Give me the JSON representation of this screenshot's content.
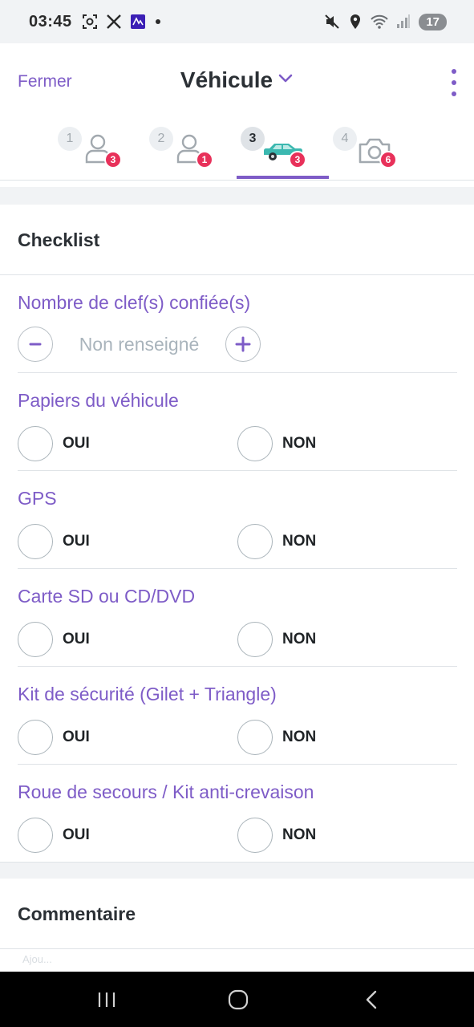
{
  "status_bar": {
    "time": "03:45",
    "battery": "17",
    "left_icons": [
      "screenshot-icon",
      "x-logo-icon",
      "app-notification-icon",
      "dot-icon"
    ],
    "right_icons": [
      "mute-icon",
      "location-icon",
      "wifi-icon",
      "signal-icon"
    ]
  },
  "header": {
    "close_label": "Fermer",
    "title": "Véhicule"
  },
  "steps": [
    {
      "number": "1",
      "icon": "person-icon",
      "badge": "3",
      "active": false
    },
    {
      "number": "2",
      "icon": "person-icon",
      "badge": "1",
      "active": false
    },
    {
      "number": "3",
      "icon": "car-icon",
      "badge": "3",
      "active": true
    },
    {
      "number": "4",
      "icon": "camera-icon",
      "badge": "6",
      "active": false
    }
  ],
  "checklist": {
    "title": "Checklist",
    "keys": {
      "label": "Nombre de clef(s) confiée(s)",
      "value": "Non renseigné"
    },
    "questions": [
      {
        "label": "Papiers du véhicule",
        "yes": "OUI",
        "no": "NON"
      },
      {
        "label": "GPS",
        "yes": "OUI",
        "no": "NON"
      },
      {
        "label": "Carte SD ou CD/DVD",
        "yes": "OUI",
        "no": "NON"
      },
      {
        "label": "Kit de sécurité (Gilet + Triangle)",
        "yes": "OUI",
        "no": "NON"
      },
      {
        "label": "Roue de secours / Kit anti-crevaison",
        "yes": "OUI",
        "no": "NON"
      }
    ]
  },
  "comment": {
    "title": "Commentaire",
    "placeholder": "Ajou..."
  },
  "colors": {
    "accent": "#7e5cc7",
    "badge": "#e8315a",
    "car": "#3bb8b0"
  }
}
